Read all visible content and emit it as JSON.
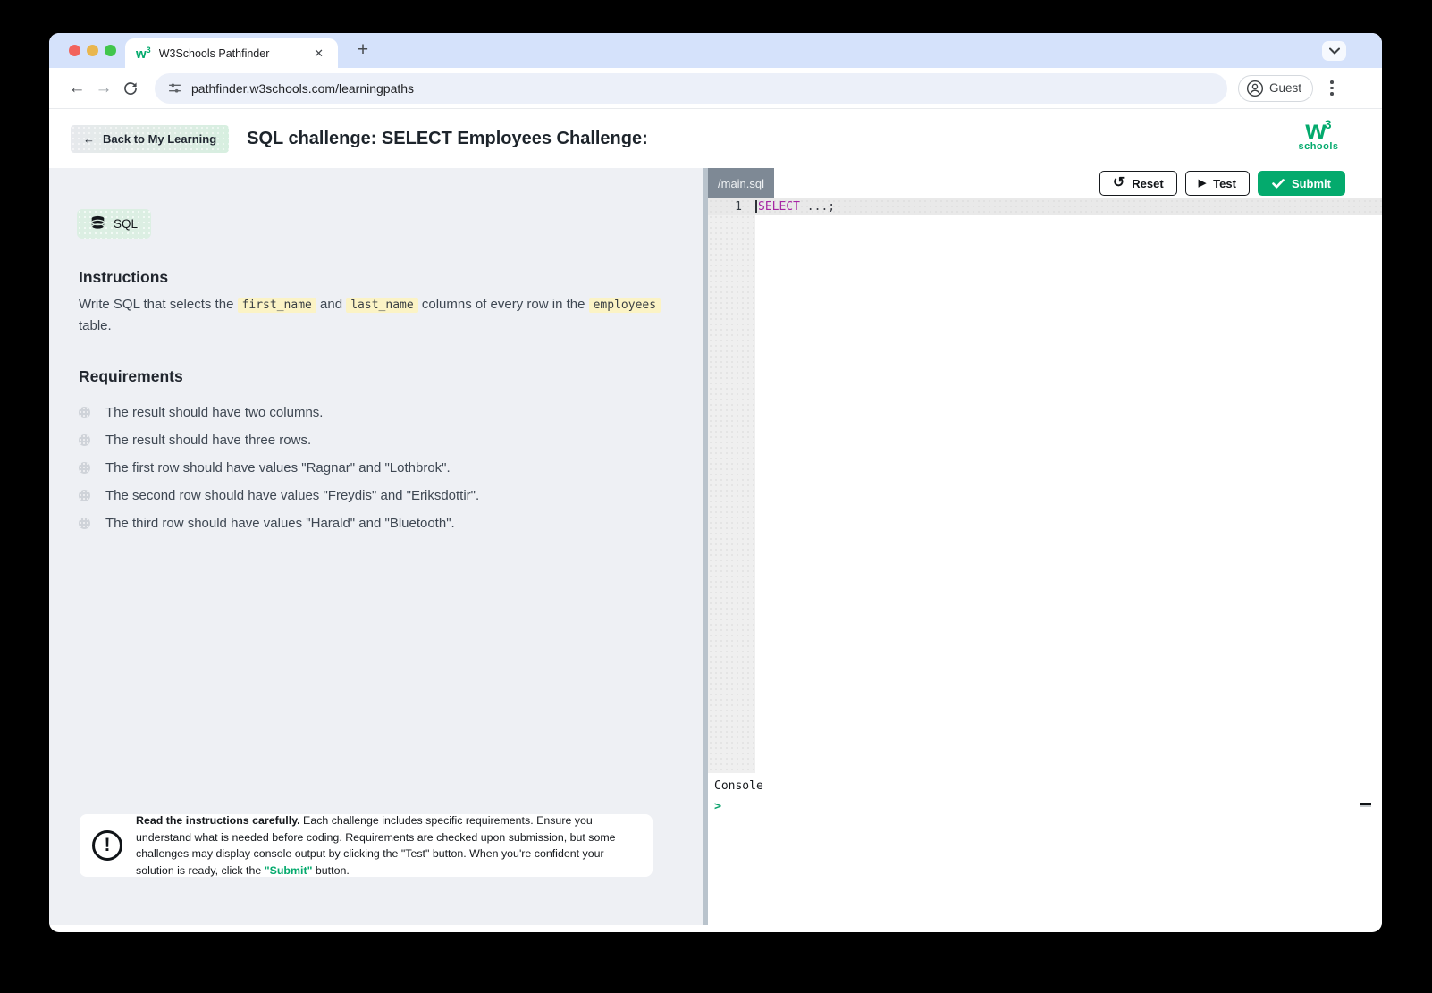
{
  "browser": {
    "tab_title": "W3Schools Pathfinder",
    "favicon_text": "w",
    "favicon_sup": "3",
    "close_glyph": "✕",
    "newtab_glyph": "+",
    "back_glyph": "←",
    "forward_glyph": "→",
    "url": "pathfinder.w3schools.com/learningpaths",
    "profile_label": "Guest"
  },
  "header": {
    "back_arrow": "←",
    "back_label": "Back to My Learning",
    "title": "SQL challenge: SELECT Employees Challenge:",
    "logo_main": "w",
    "logo_sup": "3",
    "logo_word": "schools"
  },
  "left": {
    "language_badge": "SQL",
    "instructions": {
      "heading": "Instructions",
      "pre": "Write SQL that selects the ",
      "code1": "first_name",
      "mid1": " and ",
      "code2": "last_name",
      "mid2": " columns of every row in the ",
      "code3": "employees",
      "post": " table."
    },
    "requirements": {
      "heading": "Requirements",
      "items": [
        "The result should have two columns.",
        "The result should have three rows.",
        "The first row should have values \"Ragnar\" and \"Lothbrok\".",
        "The second row should have values \"Freydis\" and \"Eriksdottir\".",
        "The third row should have values \"Harald\" and \"Bluetooth\"."
      ]
    },
    "note": {
      "icon_glyph": "!",
      "bold": "Read the instructions carefully.",
      "text1": " Each challenge includes specific requirements. Ensure you understand what is needed before coding. Requirements are checked upon submission, but some challenges may display console output by clicking the \"Test\" button. When you're confident your solution is ready, click the ",
      "submit_ref": "\"Submit\"",
      "text2": " button."
    }
  },
  "editor": {
    "file_tab": "/main.sql",
    "reset_label": "Reset",
    "reset_icon_glyph": "↺",
    "test_label": "Test",
    "play_icon_glyph": "▶",
    "submit_label": "Submit",
    "line_number": "1",
    "code_keyword": "SELECT",
    "code_rest": " ...;",
    "console_label": "Console",
    "console_prompt": ">"
  },
  "colors": {
    "brand_green": "#04aa6d",
    "keyword_purple": "#a626a4",
    "code_highlight_yellow": "#fbf3c5",
    "tabstrip_blue": "#d5e2fb",
    "panel_gray": "#eef0f4",
    "file_tab_gray": "#7e8995"
  }
}
